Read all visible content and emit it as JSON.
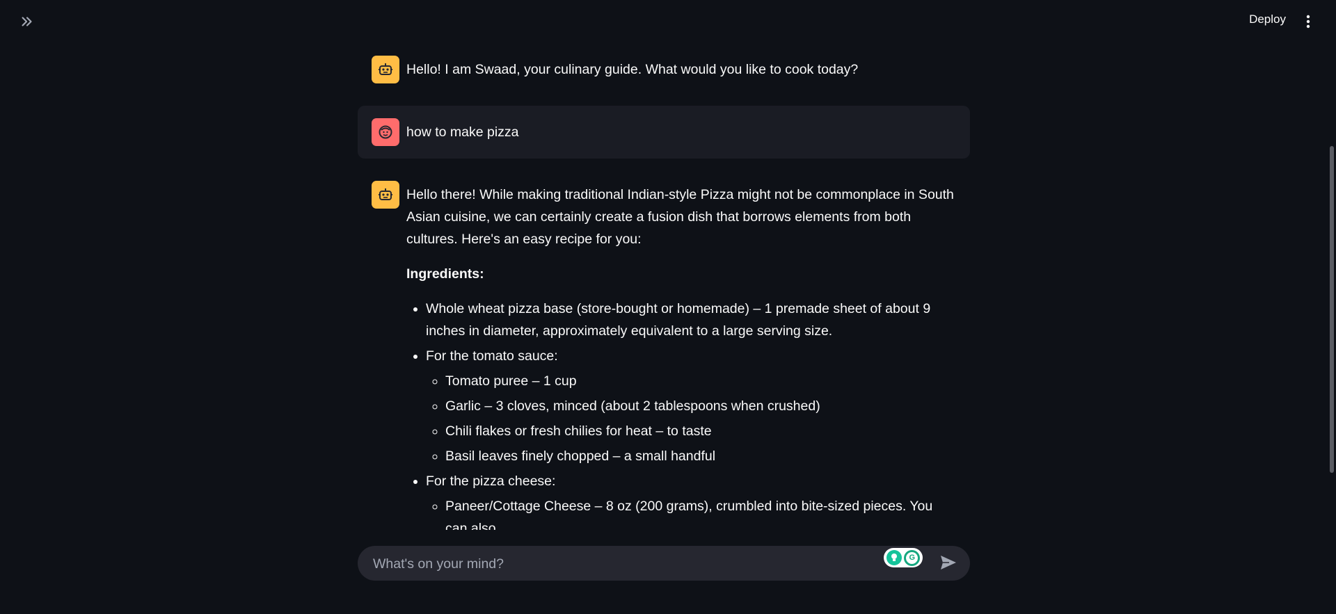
{
  "topbar": {
    "sidebar_toggle_icon": "double-chevron-right-icon",
    "deploy_label": "Deploy",
    "menu_icon": "vertical-dots-icon"
  },
  "colors": {
    "background": "#0e1117",
    "bot_avatar": "#ffbd45",
    "user_avatar": "#ff6c6c",
    "user_bubble": "#1a1c24",
    "input_bg": "#262730"
  },
  "messages": {
    "greeting": "Hello! I am Swaad, your culinary guide. What would you like to cook today?",
    "user_question": "how to make pizza",
    "response": {
      "intro": "Hello there! While making traditional Indian-style Pizza might not be commonplace in South Asian cuisine, we can certainly create a fusion dish that borrows elements from both cultures. Here's an easy recipe for you:",
      "ingredients_heading": "Ingredients:",
      "base": "Whole wheat pizza base (store-bought or homemade) – 1 premade sheet of about 9 inches in diameter, approximately equivalent to a large serving size.",
      "sauce_heading": "For the tomato sauce:",
      "sauce_items": [
        "Tomato puree – 1 cup",
        "Garlic – 3 cloves, minced (about 2 tablespoons when crushed)",
        "Chili flakes or fresh chilies for heat – to taste",
        "Basil leaves finely chopped – a small handful"
      ],
      "cheese_heading": "For the pizza cheese:",
      "cheese_items": [
        "Paneer/Cottage Cheese – 8 oz (200 grams), crumbled into bite-sized pieces. You can also"
      ]
    }
  },
  "input": {
    "placeholder": "What's on your mind?",
    "value": "",
    "send_icon": "send-icon",
    "grammarly_icon": "grammarly-icon"
  }
}
